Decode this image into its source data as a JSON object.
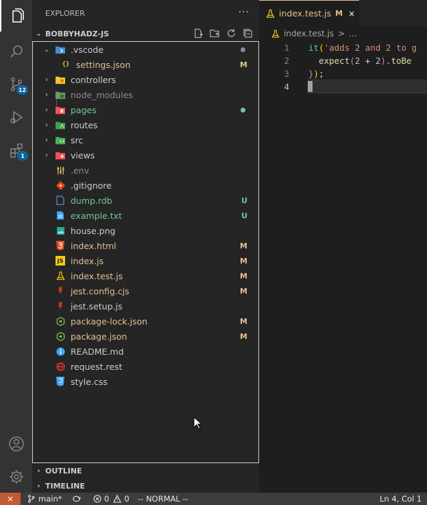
{
  "activity_bar": {
    "scm_badge": "12",
    "extensions_badge": "1"
  },
  "sidebar": {
    "title": "EXPLORER",
    "more": "···",
    "folder": "BOBBYHADZ-JS",
    "tree": [
      {
        "label": ".vscode",
        "status": "",
        "dot": "#8c8c8c",
        "color": "#cccccc"
      },
      {
        "label": "settings.json",
        "status": "M",
        "color": "#e2c08d"
      },
      {
        "label": "controllers",
        "status": "",
        "color": "#cccccc"
      },
      {
        "label": "node_modules",
        "status": "",
        "color": "#8c8c8c"
      },
      {
        "label": "pages",
        "status": "",
        "dot": "#73c991",
        "color": "#73c991"
      },
      {
        "label": "routes",
        "status": "",
        "color": "#cccccc"
      },
      {
        "label": "src",
        "status": "",
        "color": "#cccccc"
      },
      {
        "label": "views",
        "status": "",
        "color": "#cccccc"
      },
      {
        "label": ".env",
        "status": "",
        "color": "#8c8c8c"
      },
      {
        "label": ".gitignore",
        "status": "",
        "color": "#cccccc"
      },
      {
        "label": "dump.rdb",
        "status": "U",
        "color": "#73c991"
      },
      {
        "label": "example.txt",
        "status": "U",
        "color": "#73c991"
      },
      {
        "label": "house.png",
        "status": "",
        "color": "#cccccc"
      },
      {
        "label": "index.html",
        "status": "M",
        "color": "#e2c08d"
      },
      {
        "label": "index.js",
        "status": "M",
        "color": "#e2c08d"
      },
      {
        "label": "index.test.js",
        "status": "M",
        "color": "#e2c08d"
      },
      {
        "label": "jest.config.cjs",
        "status": "M",
        "color": "#e2c08d"
      },
      {
        "label": "jest.setup.js",
        "status": "",
        "color": "#cccccc"
      },
      {
        "label": "package-lock.json",
        "status": "M",
        "color": "#e2c08d"
      },
      {
        "label": "package.json",
        "status": "M",
        "color": "#e2c08d"
      },
      {
        "label": "README.md",
        "status": "",
        "color": "#cccccc"
      },
      {
        "label": "request.rest",
        "status": "",
        "color": "#cccccc"
      },
      {
        "label": "style.css",
        "status": "",
        "color": "#cccccc"
      }
    ],
    "outline": "OUTLINE",
    "timeline": "TIMELINE"
  },
  "editor": {
    "tab_label": "index.test.js",
    "tab_status": "M",
    "tab_close": "×",
    "breadcrumb_file": "index.test.js",
    "breadcrumb_sep": ">",
    "breadcrumb_more": "...",
    "line_numbers": [
      "1",
      "2",
      "3",
      "4"
    ]
  },
  "statusbar": {
    "remote": "×",
    "branch": "main*",
    "errors": "0",
    "warnings": "0",
    "mode": "-- NORMAL --",
    "position": "Ln 4, Col 1"
  },
  "colors": {
    "modified": "#e2c08d",
    "untracked": "#73c991",
    "ignored": "#8c8c8c",
    "accent": "#0e639c"
  }
}
